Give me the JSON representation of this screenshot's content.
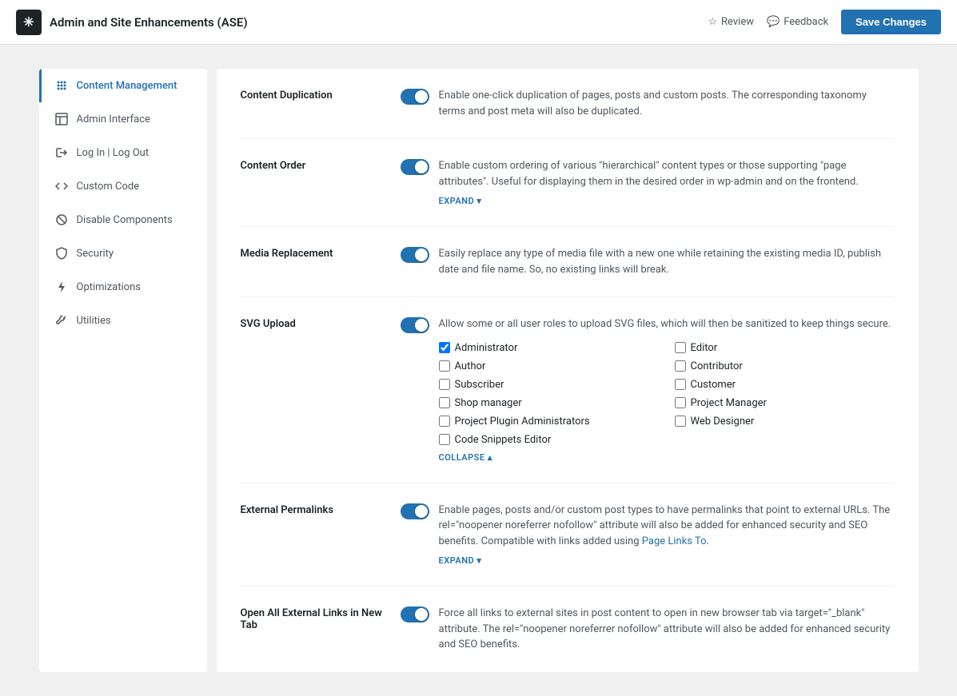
{
  "header": {
    "app_name": "Admin and Site Enhancements (ASE)",
    "review_label": "Review",
    "feedback_label": "Feedback",
    "save_label": "Save Changes"
  },
  "sidebar": {
    "items": [
      {
        "id": "content-management",
        "label": "Content Management",
        "active": true,
        "icon": "grid-icon"
      },
      {
        "id": "admin-interface",
        "label": "Admin Interface",
        "active": false,
        "icon": "layout-icon"
      },
      {
        "id": "log-in-out",
        "label": "Log In | Log Out",
        "active": false,
        "icon": "login-icon"
      },
      {
        "id": "custom-code",
        "label": "Custom Code",
        "active": false,
        "icon": "code-icon"
      },
      {
        "id": "disable-components",
        "label": "Disable Components",
        "active": false,
        "icon": "disable-icon"
      },
      {
        "id": "security",
        "label": "Security",
        "active": false,
        "icon": "shield-icon"
      },
      {
        "id": "optimizations",
        "label": "Optimizations",
        "active": false,
        "icon": "bolt-icon"
      },
      {
        "id": "utilities",
        "label": "Utilities",
        "active": false,
        "icon": "tools-icon"
      }
    ]
  },
  "settings": [
    {
      "id": "content-duplication",
      "label": "Content Duplication",
      "enabled": true,
      "description": "Enable one-click duplication of pages, posts and custom posts. The corresponding taxonomy terms and post meta will also be duplicated.",
      "has_expand": false,
      "has_collapse": false,
      "has_checkboxes": false
    },
    {
      "id": "content-order",
      "label": "Content Order",
      "enabled": true,
      "description": "Enable custom ordering of various \"hierarchical\" content types or those supporting \"page attributes\". Useful for displaying them in the desired order in wp-admin and on the frontend.",
      "has_expand": true,
      "expand_label": "EXPAND ▾",
      "has_collapse": false,
      "has_checkboxes": false
    },
    {
      "id": "media-replacement",
      "label": "Media Replacement",
      "enabled": true,
      "description": "Easily replace any type of media file with a new one while retaining the existing media ID, publish date and file name. So, no existing links will break.",
      "has_expand": false,
      "has_collapse": false,
      "has_checkboxes": false
    },
    {
      "id": "svg-upload",
      "label": "SVG Upload",
      "enabled": true,
      "description": "Allow some or all user roles to upload SVG files, which will then be sanitized to keep things secure.",
      "has_expand": false,
      "has_collapse": true,
      "collapse_label": "COLLAPSE ▴",
      "has_checkboxes": true,
      "checkboxes": [
        {
          "id": "cb-administrator",
          "label": "Administrator",
          "checked": true
        },
        {
          "id": "cb-editor",
          "label": "Editor",
          "checked": false
        },
        {
          "id": "cb-author",
          "label": "Author",
          "checked": false
        },
        {
          "id": "cb-contributor",
          "label": "Contributor",
          "checked": false
        },
        {
          "id": "cb-subscriber",
          "label": "Subscriber",
          "checked": false
        },
        {
          "id": "cb-customer",
          "label": "Customer",
          "checked": false
        },
        {
          "id": "cb-shop-manager",
          "label": "Shop manager",
          "checked": false
        },
        {
          "id": "cb-project-manager",
          "label": "Project Manager",
          "checked": false
        },
        {
          "id": "cb-project-plugin-admins",
          "label": "Project Plugin Administrators",
          "checked": false
        },
        {
          "id": "cb-web-designer",
          "label": "Web Designer",
          "checked": false
        },
        {
          "id": "cb-code-snippets-editor",
          "label": "Code Snippets Editor",
          "checked": false
        }
      ]
    },
    {
      "id": "external-permalinks",
      "label": "External Permalinks",
      "enabled": true,
      "description": "Enable pages, posts and/or custom post types to have permalinks that point to external URLs. The rel=\"noopener noreferrer nofollow\" attribute will also be added for enhanced security and SEO benefits. Compatible with links added using ",
      "description_link_text": "Page Links To",
      "description_after": ".",
      "has_expand": true,
      "expand_label": "EXPAND ▾",
      "has_collapse": false,
      "has_checkboxes": false
    },
    {
      "id": "open-all-external-links",
      "label": "Open All External Links in New Tab",
      "enabled": true,
      "description": "Force all links to external sites in post content to open in new browser tab via target=\"_blank\" attribute. The rel=\"noopener noreferrer nofollow\" attribute will also be added for enhanced security and SEO benefits.",
      "has_expand": false,
      "has_collapse": false,
      "has_checkboxes": false
    }
  ]
}
